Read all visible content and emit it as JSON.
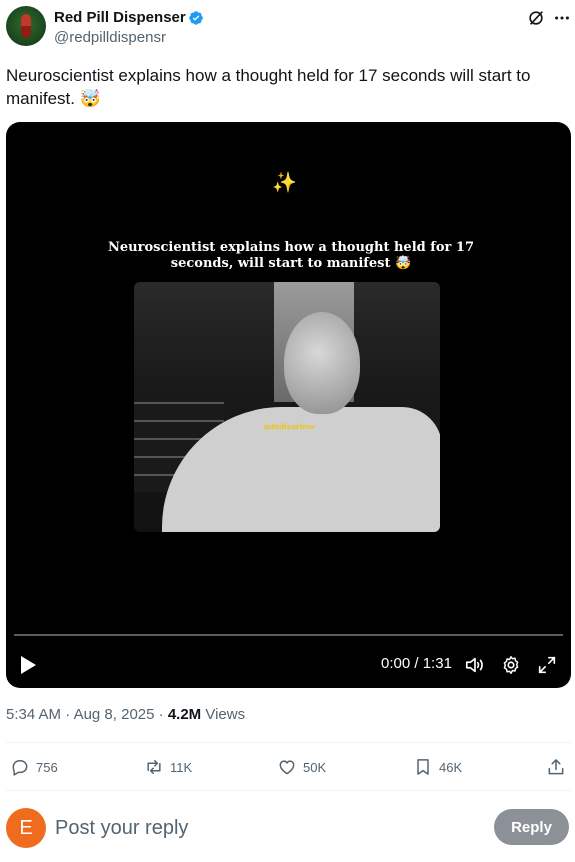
{
  "author": {
    "display_name": "Red Pill Dispenser",
    "handle": "@redpilldispensr",
    "verified": true
  },
  "tweet": {
    "text": "Neuroscientist explains how a thought held for 17 seconds will start to manifest. 🤯"
  },
  "video": {
    "overlay_caption": "Neuroscientist explains how a thought held for 17 seconds, will start to manifest 🤯",
    "sparkle": "✨",
    "watermark": "mindfearless",
    "current_time": "0:00",
    "duration": "1:31",
    "progress": 0
  },
  "meta": {
    "time": "5:34 AM",
    "date": "Aug 8, 2025",
    "views_count": "4.2M",
    "views_label": "Views"
  },
  "actions": {
    "replies": "756",
    "reposts": "11K",
    "likes": "50K",
    "bookmarks": "46K"
  },
  "reply_box": {
    "avatar_initial": "E",
    "placeholder": "Post your reply",
    "button_label": "Reply"
  },
  "icons": [
    "grok-icon",
    "more-icon",
    "play-icon",
    "volume-icon",
    "settings-icon",
    "fullscreen-icon",
    "reply-icon",
    "repost-icon",
    "like-icon",
    "bookmark-icon",
    "share-icon"
  ],
  "colors": {
    "verified_blue": "#1d9bf0",
    "secondary_text": "#536471",
    "reply_avatar": "#ef6c1e",
    "reply_button": "#8b9196"
  }
}
